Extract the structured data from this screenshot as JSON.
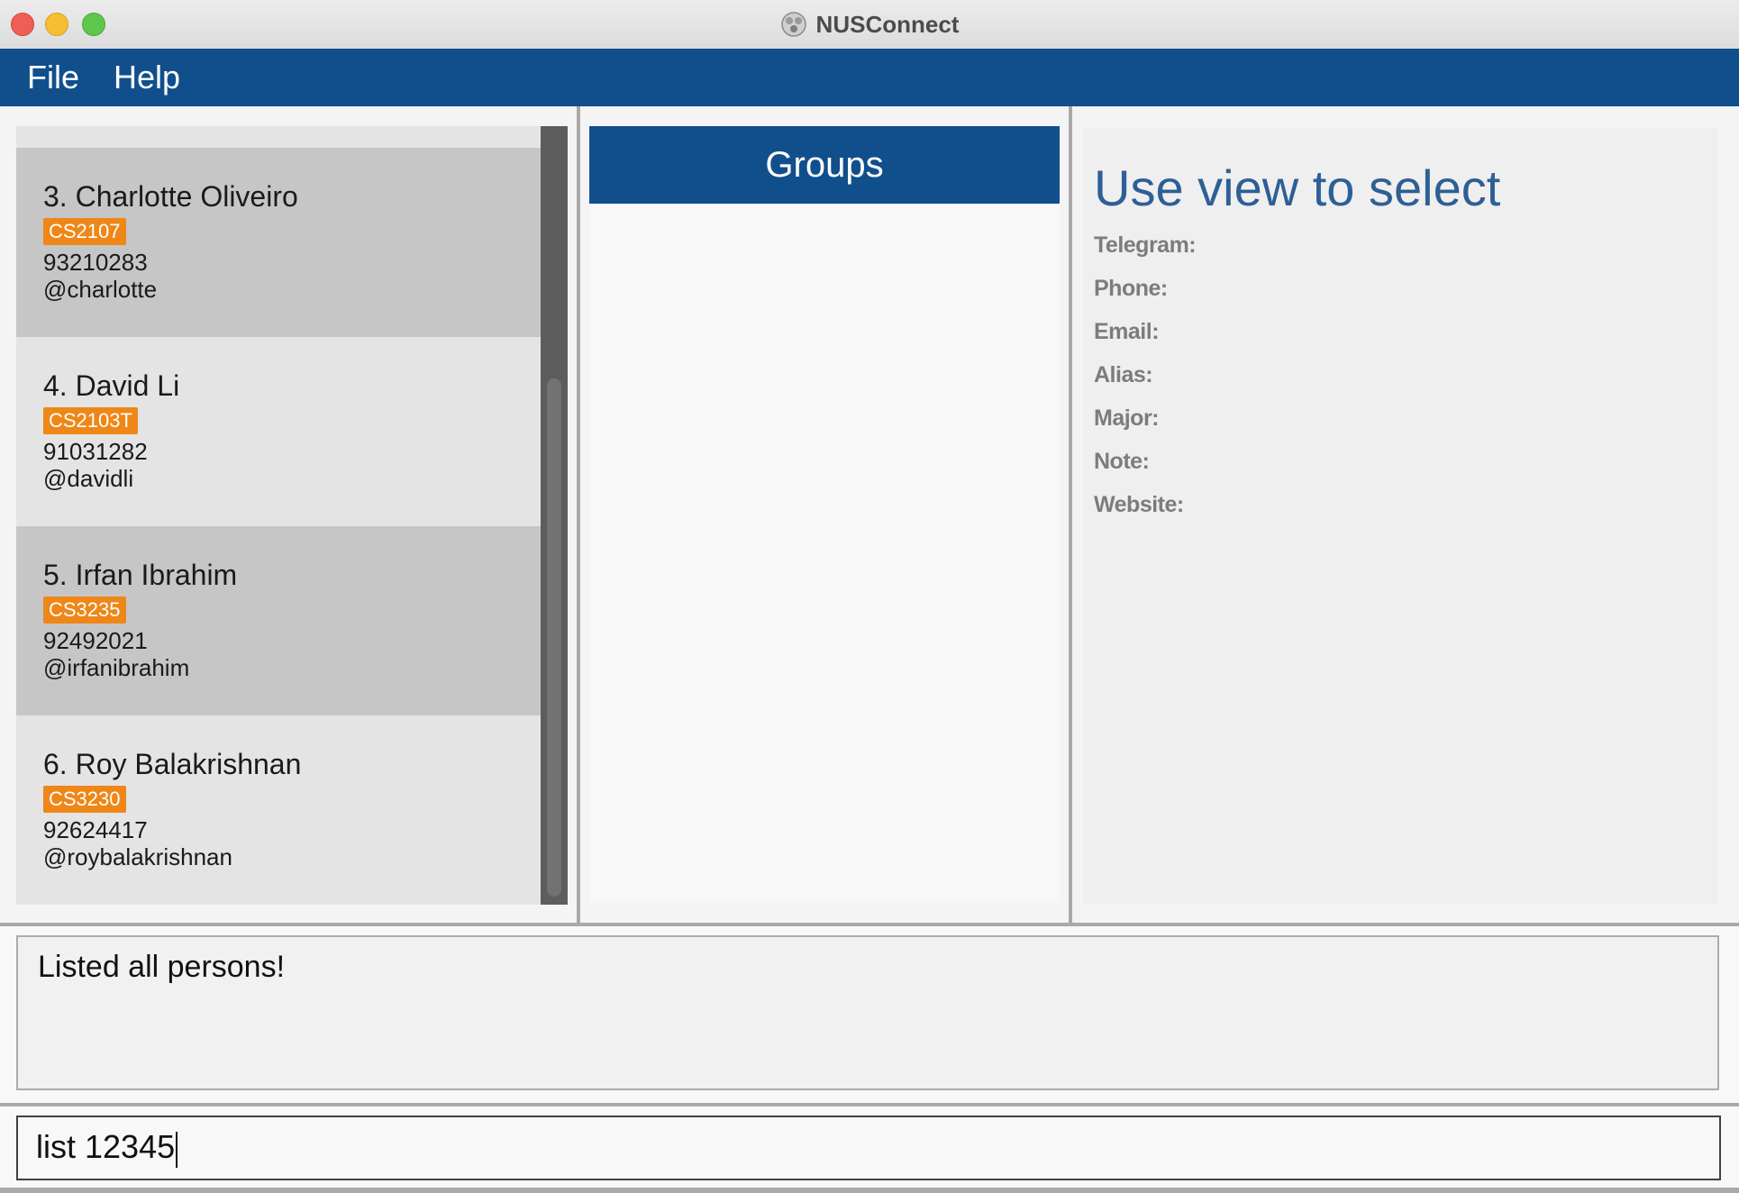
{
  "window": {
    "title": "NUSConnect",
    "icon": "app-logo-icon"
  },
  "menu": {
    "items": [
      "File",
      "Help"
    ]
  },
  "person_list": {
    "cards": [
      {
        "name": "3. Charlotte Oliveiro",
        "tag": "CS2107",
        "phone": "93210283",
        "handle": "@charlotte"
      },
      {
        "name": "4. David Li",
        "tag": "CS2103T",
        "phone": "91031282",
        "handle": "@davidli"
      },
      {
        "name": "5. Irfan Ibrahim",
        "tag": "CS3235",
        "phone": "92492021",
        "handle": "@irfanibrahim"
      },
      {
        "name": "6. Roy Balakrishnan",
        "tag": "CS3230",
        "phone": "92624417",
        "handle": "@roybalakrishnan"
      }
    ]
  },
  "groups": {
    "title": "Groups"
  },
  "details": {
    "heading": "Use view to select",
    "fields": [
      "Telegram:",
      "Phone:",
      "Email:",
      "Alias:",
      "Major:",
      "Note:",
      "Website:"
    ]
  },
  "result": {
    "text": "Listed all persons!"
  },
  "command": {
    "value": "list 12345"
  },
  "colors": {
    "accent": "#114f8c",
    "tag": "#ee8717",
    "heading": "#2e5f96"
  }
}
